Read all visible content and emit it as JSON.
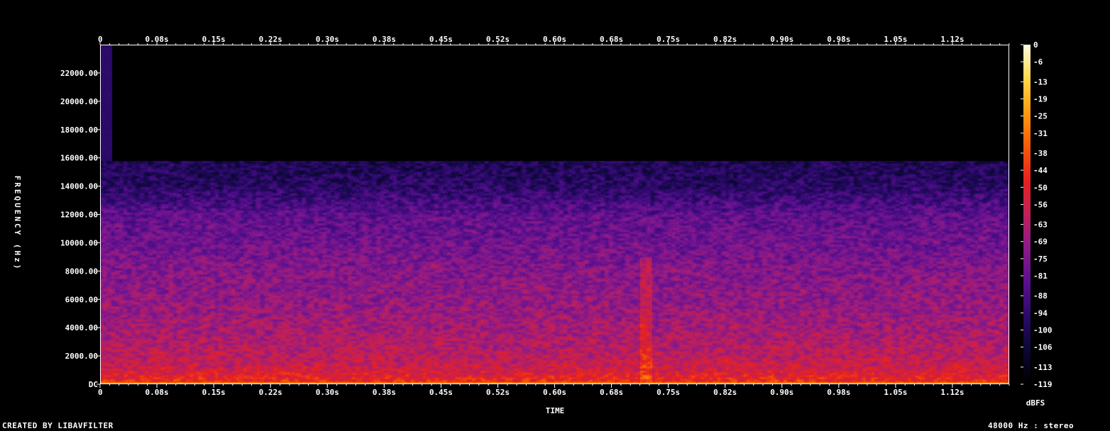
{
  "footer": {
    "left": "CREATED BY LIBAVFILTER",
    "right": "48000 Hz : stereo"
  },
  "chart_data": {
    "type": "heatmap",
    "title": "",
    "xlabel": "TIME",
    "ylabel": "FREQUENCY (Hz)",
    "colorbar_label": "dBFS",
    "xlim": [
      0,
      1.2
    ],
    "ylim": [
      0,
      24000
    ],
    "clim": [
      -119,
      0
    ],
    "x_ticks": [
      "0",
      "0.08s",
      "0.15s",
      "0.22s",
      "0.30s",
      "0.38s",
      "0.45s",
      "0.52s",
      "0.60s",
      "0.68s",
      "0.75s",
      "0.82s",
      "0.90s",
      "0.98s",
      "1.05s",
      "1.12s"
    ],
    "x_tick_values": [
      0,
      0.075,
      0.15,
      0.225,
      0.3,
      0.375,
      0.45,
      0.525,
      0.6,
      0.675,
      0.75,
      0.825,
      0.9,
      0.975,
      1.05,
      1.125
    ],
    "y_ticks": [
      "DC",
      "2000.00",
      "4000.00",
      "6000.00",
      "8000.00",
      "10000.00",
      "12000.00",
      "14000.00",
      "16000.00",
      "18000.00",
      "20000.00",
      "22000.00"
    ],
    "y_tick_values": [
      0,
      2000,
      4000,
      6000,
      8000,
      10000,
      12000,
      14000,
      16000,
      18000,
      20000,
      22000
    ],
    "colorbar_ticks": [
      "0",
      "-6",
      "-13",
      "-19",
      "-25",
      "-31",
      "-38",
      "-44",
      "-50",
      "-56",
      "-63",
      "-69",
      "-75",
      "-81",
      "-88",
      "-94",
      "-100",
      "-106",
      "-113",
      "-119"
    ],
    "colorbar_tick_values": [
      0,
      -6,
      -13,
      -19,
      -25,
      -31,
      -38,
      -44,
      -50,
      -56,
      -63,
      -69,
      -75,
      -81,
      -88,
      -94,
      -100,
      -106,
      -113,
      -119
    ],
    "colormap": [
      "#000000",
      "#0b0733",
      "#2a0a6a",
      "#5a0f90",
      "#8a1a8a",
      "#c0205a",
      "#e8201e",
      "#f55a0a",
      "#ff9a10",
      "#ffd84a",
      "#fffbe0"
    ],
    "grid": false,
    "spectral_profile": {
      "frequencies": [
        0,
        200,
        1000,
        2000,
        4000,
        6000,
        8000,
        10000,
        12000,
        14000,
        15800,
        16000,
        24000
      ],
      "levels_dbfs": [
        -38,
        -45,
        -55,
        -60,
        -66,
        -70,
        -73,
        -78,
        -82,
        -96,
        -100,
        -119,
        -119
      ],
      "lowpass_cutoff_hz": 15800,
      "onset_broadband_until_s": 0.015,
      "transient_time_s": 0.72
    }
  }
}
